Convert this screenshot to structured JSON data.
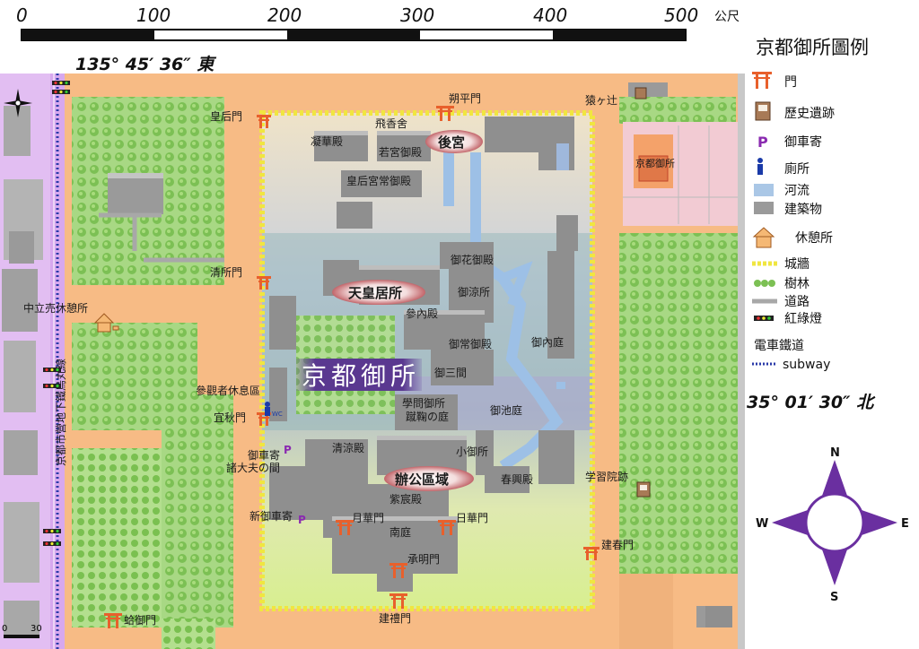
{
  "scale_bar": {
    "ticks": [
      "0",
      "100",
      "200",
      "300",
      "400",
      "500"
    ],
    "unit": "公尺"
  },
  "coords": {
    "longitude": "135° 45′ 36″ 東",
    "latitude": "35° 01′ 30″ 北"
  },
  "map": {
    "title": "京都御所",
    "pills": {
      "rear_palace": "後宮",
      "emperor": "天皇居所",
      "office": "辦公區域"
    },
    "labels": {
      "feixiang": "飛香舍",
      "ningxiang": "凝華殿",
      "ruoguan": "若宮御殿",
      "huanghou": "皇后宮常御殿",
      "yuhuadian": "御花御殿",
      "yuxuesuo": "御涼所",
      "canneidian": "參內殿",
      "yuchangyu": "御常御殿",
      "yuneiting": "御內庭",
      "yusanjian": "御三間",
      "xuewensuo": "學問御所",
      "mitsuting": "蹴鞠の庭",
      "yuchiting": "御池庭",
      "qingliangdian": "清涼殿",
      "xiaoyusuo": "小御所",
      "chunxingdian": "春興殿",
      "zichendian": "紫宸殿",
      "nanting": "南庭",
      "yuehuamen": "月華門",
      "rihuamen": "日華門",
      "chengmingmen": "承明門",
      "jianlimen": "建禮門",
      "jianchunmen": "建春門",
      "shuopingmen": "朔平門",
      "huanghoumen": "皇后門",
      "qingsuomen": "清所門",
      "yiqiumen": "宜秋門",
      "canguanzhe": "參觀者休息區",
      "yuchejiyi": "御車寄",
      "zhudafu": "諸大夫の間",
      "xinyuche": "新御車寄",
      "ganmen": "蛤御門",
      "zhongli": "中立売休憩所",
      "xueixiyuan": "学習院跡",
      "yuanke": "猿ヶ辻",
      "subway_line": "京都市營地下鐵烏丸線",
      "inset": "京都御所",
      "wc": "WC",
      "scale_small_0": "0",
      "scale_small_30": "30"
    }
  },
  "legend": {
    "title": "京都御所圖例",
    "items": [
      {
        "key": "gate",
        "label": "門"
      },
      {
        "key": "historic",
        "label": "歷史遺跡"
      },
      {
        "key": "parking",
        "label": "御車寄",
        "symbol": "P"
      },
      {
        "key": "toilet",
        "label": "廁所"
      },
      {
        "key": "river",
        "label": "河流"
      },
      {
        "key": "building",
        "label": "建築物"
      },
      {
        "key": "rest",
        "label": "休憩所"
      },
      {
        "key": "wall",
        "label": "城牆"
      },
      {
        "key": "forest",
        "label": "樹林"
      },
      {
        "key": "road",
        "label": "道路"
      },
      {
        "key": "traffic",
        "label": "紅綠燈"
      },
      {
        "key": "tram",
        "label": "電車鐵道"
      },
      {
        "key": "subway",
        "label": "subway"
      }
    ]
  },
  "compass": {
    "n": "N",
    "s": "S",
    "e": "E",
    "w": "W"
  },
  "colors": {
    "road": "#f5b07a",
    "forest": "#9fd27a",
    "tree": "#6fb04a",
    "building": "#9a9a9a",
    "river": "#aac7e6",
    "wall": "#f2e64a",
    "tram": "#c99ee6",
    "gate": "#e8602c",
    "compass": "#6a2fa0"
  }
}
